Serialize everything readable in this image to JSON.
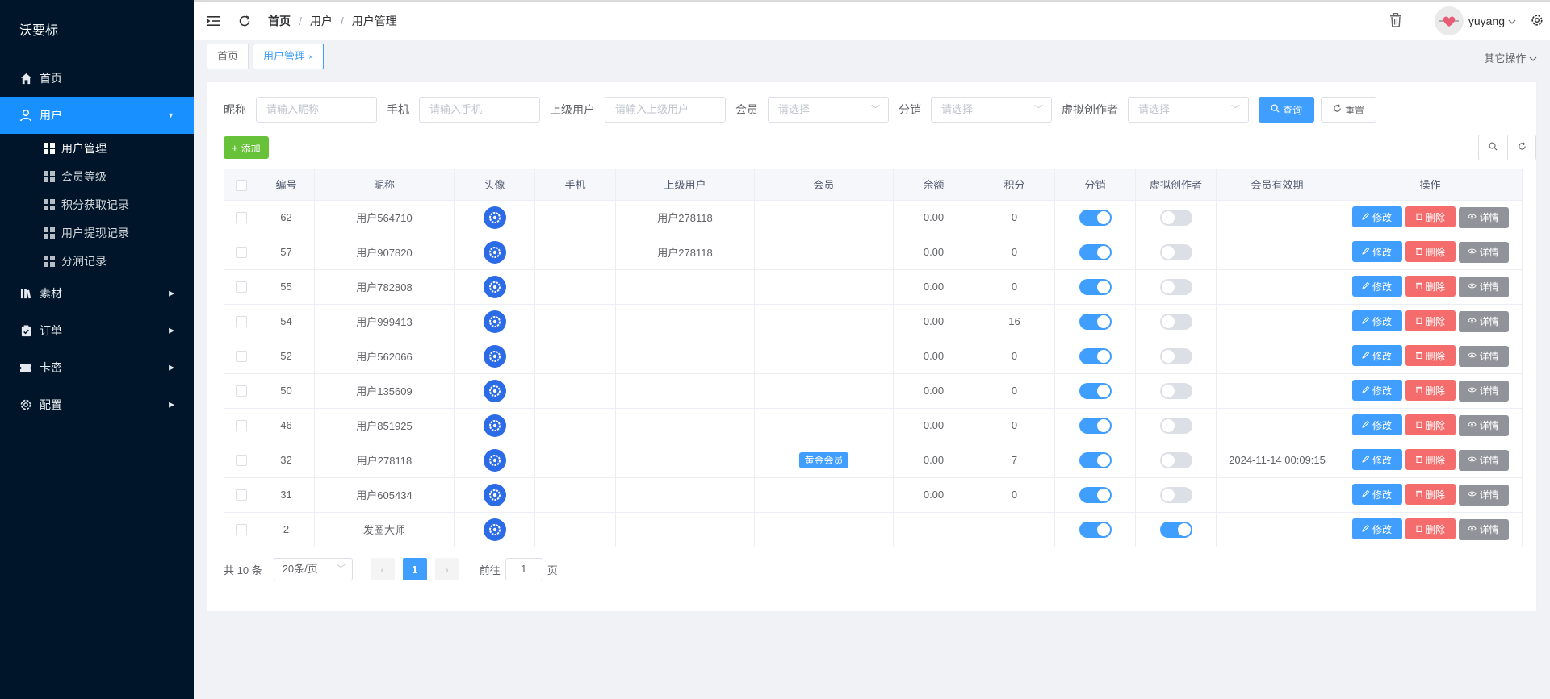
{
  "app": {
    "logo": "沃要标"
  },
  "sidebar": {
    "items": [
      {
        "label": "首页",
        "icon": "home-icon"
      },
      {
        "label": "用户",
        "icon": "user-icon"
      },
      {
        "label": "素材",
        "icon": "book-icon"
      },
      {
        "label": "订单",
        "icon": "clipboard-icon"
      },
      {
        "label": "卡密",
        "icon": "ticket-icon"
      },
      {
        "label": "配置",
        "icon": "gear-icon"
      }
    ],
    "sub_items": [
      "用户管理",
      "会员等级",
      "积分获取记录",
      "用户提现记录",
      "分润记录"
    ]
  },
  "header": {
    "breadcrumb": [
      "首页",
      "用户",
      "用户管理"
    ],
    "username": "yuyang"
  },
  "tags": {
    "items": [
      "首页",
      "用户管理"
    ],
    "close": "×",
    "other_ops": "其它操作"
  },
  "filter": {
    "nickname_label": "昵称",
    "nickname_placeholder": "请输入昵称",
    "phone_label": "手机",
    "phone_placeholder": "请输入手机",
    "parent_label": "上级用户",
    "parent_placeholder": "请输入上级用户",
    "member_label": "会员",
    "member_placeholder": "请选择",
    "dist_label": "分销",
    "dist_placeholder": "请选择",
    "creator_label": "虚拟创作者",
    "creator_placeholder": "请选择",
    "search_btn": "查询",
    "reset_btn": "重置"
  },
  "toolbar": {
    "add": "添加"
  },
  "table": {
    "headers": [
      "编号",
      "昵称",
      "头像",
      "手机",
      "上级用户",
      "会员",
      "余额",
      "积分",
      "分销",
      "虚拟创作者",
      "会员有效期",
      "操作"
    ],
    "actions": {
      "edit": "修改",
      "delete": "删除",
      "detail": "详情"
    },
    "rows": [
      {
        "id": "62",
        "nickname": "用户564710",
        "phone": "",
        "parent": "用户278118",
        "member": "",
        "balance": "0.00",
        "points": "0",
        "dist": true,
        "creator": false,
        "expiry": ""
      },
      {
        "id": "57",
        "nickname": "用户907820",
        "phone": "",
        "parent": "用户278118",
        "member": "",
        "balance": "0.00",
        "points": "0",
        "dist": true,
        "creator": false,
        "expiry": ""
      },
      {
        "id": "55",
        "nickname": "用户782808",
        "phone": "",
        "parent": "",
        "member": "",
        "balance": "0.00",
        "points": "0",
        "dist": true,
        "creator": false,
        "expiry": ""
      },
      {
        "id": "54",
        "nickname": "用户999413",
        "phone": "",
        "parent": "",
        "member": "",
        "balance": "0.00",
        "points": "16",
        "dist": true,
        "creator": false,
        "expiry": ""
      },
      {
        "id": "52",
        "nickname": "用户562066",
        "phone": "",
        "parent": "",
        "member": "",
        "balance": "0.00",
        "points": "0",
        "dist": true,
        "creator": false,
        "expiry": ""
      },
      {
        "id": "50",
        "nickname": "用户135609",
        "phone": "",
        "parent": "",
        "member": "",
        "balance": "0.00",
        "points": "0",
        "dist": true,
        "creator": false,
        "expiry": ""
      },
      {
        "id": "46",
        "nickname": "用户851925",
        "phone": "",
        "parent": "",
        "member": "",
        "balance": "0.00",
        "points": "0",
        "dist": true,
        "creator": false,
        "expiry": ""
      },
      {
        "id": "32",
        "nickname": "用户278118",
        "phone": "",
        "parent": "",
        "member": "黄金会员",
        "balance": "0.00",
        "points": "7",
        "dist": true,
        "creator": false,
        "expiry": "2024-11-14 00:09:15"
      },
      {
        "id": "31",
        "nickname": "用户605434",
        "phone": "",
        "parent": "",
        "member": "",
        "balance": "0.00",
        "points": "0",
        "dist": true,
        "creator": false,
        "expiry": ""
      },
      {
        "id": "2",
        "nickname": "发圈大师",
        "phone": "",
        "parent": "",
        "member": "",
        "balance": "",
        "points": "",
        "dist": true,
        "creator": true,
        "expiry": ""
      }
    ]
  },
  "pagination": {
    "total": "共 10 条",
    "page_size": "20条/页",
    "current": "1",
    "goto_label": "前往",
    "goto_value": "1",
    "page_unit": "页"
  },
  "colors": {
    "sidebar_bg": "#001529",
    "primary": "#409eff",
    "success": "#67c23a",
    "danger": "#f56c6c",
    "info": "#909399"
  }
}
